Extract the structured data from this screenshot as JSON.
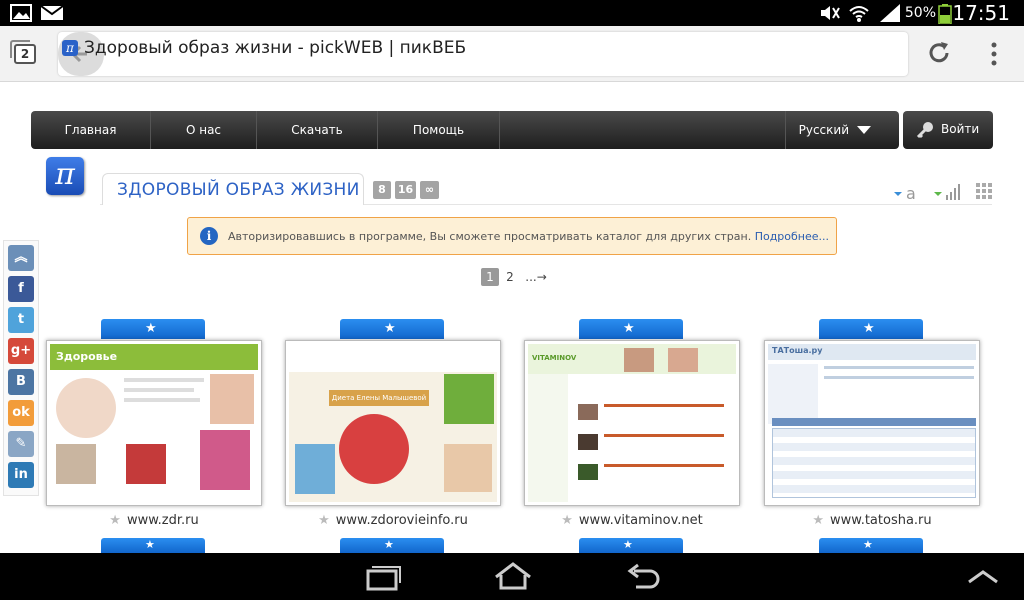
{
  "status_bar": {
    "battery": "50%",
    "time": "17:51",
    "icons": [
      "image-icon",
      "mail-icon",
      "mute-icon",
      "wifi-icon",
      "signal-icon",
      "battery-icon"
    ]
  },
  "browser": {
    "tab_count": "2",
    "page_title": "Здоровый образ жизни - pickWEB | пикВЕБ",
    "favicon": "π"
  },
  "nav": {
    "items": [
      "Главная",
      "О нас",
      "Скачать",
      "Помощь"
    ],
    "language": "Русский",
    "login": "Войти"
  },
  "header": {
    "logo": "π",
    "category_title": "ЗДОРОВЫЙ ОБРАЗ ЖИЗНИ",
    "zoom_options": [
      "8",
      "16",
      "∞"
    ]
  },
  "info_banner": {
    "icon": "i",
    "text": "Авторизировавшись в программе, Вы сможете просматривать каталог для других стран.",
    "link": "Подробнее..."
  },
  "pager": {
    "current": "1",
    "next_page": "2",
    "more": "...→"
  },
  "share_buttons": [
    "collapse",
    "facebook",
    "twitter",
    "google-plus",
    "vkontakte",
    "odnoklassniki",
    "mail",
    "linkedin"
  ],
  "share_glyphs": [
    "︽",
    "f",
    "t",
    "g+",
    "B",
    "ok",
    "✎",
    "in"
  ],
  "share_colors": [
    "#6b8fb8",
    "#3b5998",
    "#4fa3db",
    "#d5493a",
    "#4c75a3",
    "#f29c3a",
    "#8aa6c5",
    "#2e7ab5"
  ],
  "sites": [
    {
      "url": "www.zdr.ru",
      "shot_title": "Здоровье",
      "theme": "#8cbd3a"
    },
    {
      "url": "www.zdorovieinfo.ru",
      "shot_title": "Диета Елены Малышевой",
      "theme": "#d8a24a"
    },
    {
      "url": "www.vitaminov.net",
      "shot_title": "VITAMINOV",
      "theme": "#7fc04a"
    },
    {
      "url": "www.tatosha.ru",
      "shot_title": "ТАТоша.ру",
      "theme": "#6a8fc0"
    }
  ],
  "fav_glyph": "★",
  "colors": {
    "accent_blue": "#2d62c5",
    "nav_dark": "#2a2a2a",
    "banner_bg": "#fdf0d6",
    "banner_border": "#f0a347"
  }
}
